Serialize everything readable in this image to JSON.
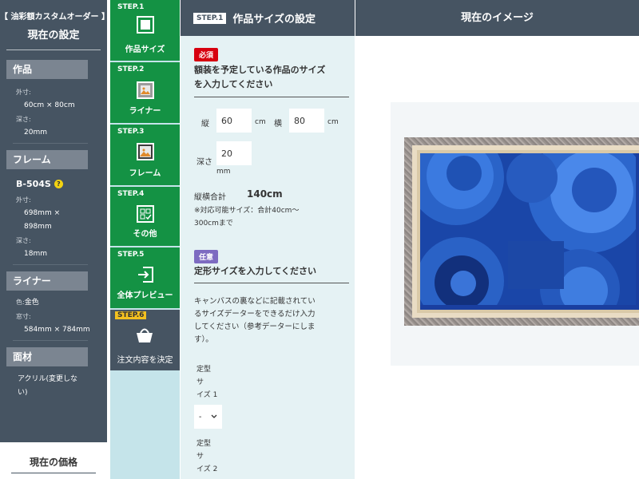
{
  "summary": {
    "brand": "【 油彩額カスタムオーダー 】",
    "current_title": "現在の設定",
    "artwork": {
      "head": "作品",
      "outer_label": "外寸:",
      "outer_value": "60cm × 80cm",
      "depth_label": "深さ:",
      "depth_value": "20mm"
    },
    "frame": {
      "head": "フレーム",
      "code": "B-504S",
      "help": "?",
      "outer_label": "外寸:",
      "outer_value1": "698mm ×",
      "outer_value2": "898mm",
      "depth_label": "深さ:",
      "depth_value": "18mm"
    },
    "liner": {
      "head": "ライナー",
      "color_label": "色:",
      "color_value": "金色",
      "window_label": "窓寸:",
      "window_value": "584mm × 784mm"
    },
    "face": {
      "head": "面材",
      "value1": "アクリル(変更しな",
      "value2": "い)"
    },
    "price_label": "現在の価格"
  },
  "steps": [
    {
      "num": "STEP.1",
      "label": "作品サイズ",
      "icon": "canvas-icon"
    },
    {
      "num": "STEP.2",
      "label": "ライナー",
      "icon": "liner-icon"
    },
    {
      "num": "STEP.3",
      "label": "フレーム",
      "icon": "frame-icon"
    },
    {
      "num": "STEP.4",
      "label": "その他",
      "icon": "options-icon"
    },
    {
      "num": "STEP.5",
      "label": "全体プレビュー",
      "icon": "preview-icon"
    },
    {
      "num": "STEP.6",
      "label": "注文内容を決定",
      "icon": "basket-icon"
    }
  ],
  "form": {
    "step_badge": "STEP.1",
    "title": "作品サイズの設定",
    "required_tag": "必須",
    "size_q1": "額装を予定している作品のサイズ",
    "size_q2": "を入力してください",
    "height_label": "縦",
    "height_value": "60",
    "width_label": "横",
    "width_value": "80",
    "unit_cm": "cm",
    "depth_label": "深さ",
    "depth_value": "20",
    "unit_mm": "mm",
    "total_label": "縦横合計",
    "total_value": "140cm",
    "note1": "※対応可能サイズ：合計40cm〜",
    "note2": "300cmまで",
    "optional_tag": "任意",
    "std_q": "定形サイズを入力してください",
    "desc": [
      "キャンバスの裏などに記載されてい",
      "るサイズデーターをできるだけ入力",
      "してください（参考データーにしま",
      "す）。"
    ],
    "std1_label": [
      "定型",
      "サ",
      "イズ 1"
    ],
    "std1_value": "-",
    "std2_label": [
      "定型",
      "サ",
      "イズ 2"
    ]
  },
  "preview": {
    "title": "現在のイメージ"
  },
  "colors": {
    "panel": "#465462",
    "step_green": "#149244",
    "form_bg": "#e5f2f4",
    "step_col_bg": "#c5e4ea",
    "required": "#d7000f",
    "optional": "#7d6bc1"
  }
}
